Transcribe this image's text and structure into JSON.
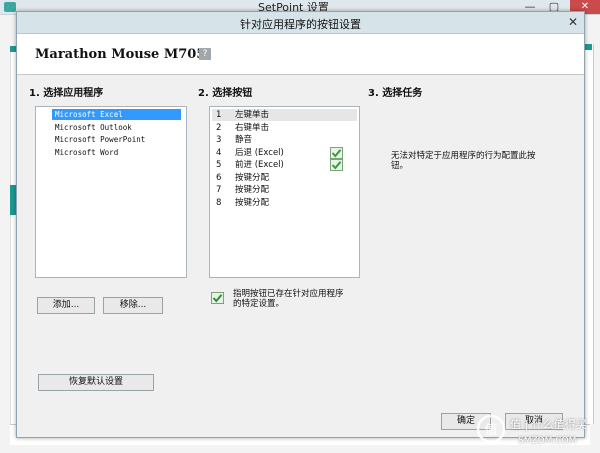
{
  "background_window": {
    "title": "SetPoint 设置",
    "minimize": "—",
    "maximize": "▢",
    "close": "✕"
  },
  "dialog": {
    "title": "针对应用程序的按钮设置",
    "close": "✕",
    "heading": "Marathon Mouse M705",
    "help": "?"
  },
  "steps": {
    "step1": "1. 选择应用程序",
    "step2": "2. 选择按钮",
    "step3": "3. 选择任务"
  },
  "applications": [
    {
      "label": "Microsoft Excel",
      "selected": true
    },
    {
      "label": "Microsoft Outlook",
      "selected": false
    },
    {
      "label": "Microsoft PowerPoint",
      "selected": false
    },
    {
      "label": "Microsoft Word",
      "selected": false
    }
  ],
  "buttons": [
    {
      "num": "1",
      "label": "左键单击",
      "selected": true,
      "has_app_setting": false
    },
    {
      "num": "2",
      "label": "右键单击",
      "selected": false,
      "has_app_setting": false
    },
    {
      "num": "3",
      "label": "静音",
      "selected": false,
      "has_app_setting": false
    },
    {
      "num": "4",
      "label": "后退 (Excel)",
      "selected": false,
      "has_app_setting": true
    },
    {
      "num": "5",
      "label": "前进 (Excel)",
      "selected": false,
      "has_app_setting": true
    },
    {
      "num": "6",
      "label": "按键分配",
      "selected": false,
      "has_app_setting": false
    },
    {
      "num": "7",
      "label": "按键分配",
      "selected": false,
      "has_app_setting": false
    },
    {
      "num": "8",
      "label": "按键分配",
      "selected": false,
      "has_app_setting": false
    }
  ],
  "add_button": "添加...",
  "remove_button": "移除...",
  "restore_button": "恢复默认设置",
  "legend_line1": "指明按钮已存在针对应用程序",
  "legend_line2": "的特定设置。",
  "task_line1": "无法对特定于应用程序的行为配置此按",
  "task_line2": "钮。",
  "ok_button": "确定",
  "cancel_button": "取消",
  "watermark": {
    "line1": "值 | 什么值得买",
    "line2": "SMZDM.COM"
  },
  "colors": {
    "selection": "#3399ff",
    "check": "#3a9b3a",
    "accent": "#1a9a91"
  }
}
